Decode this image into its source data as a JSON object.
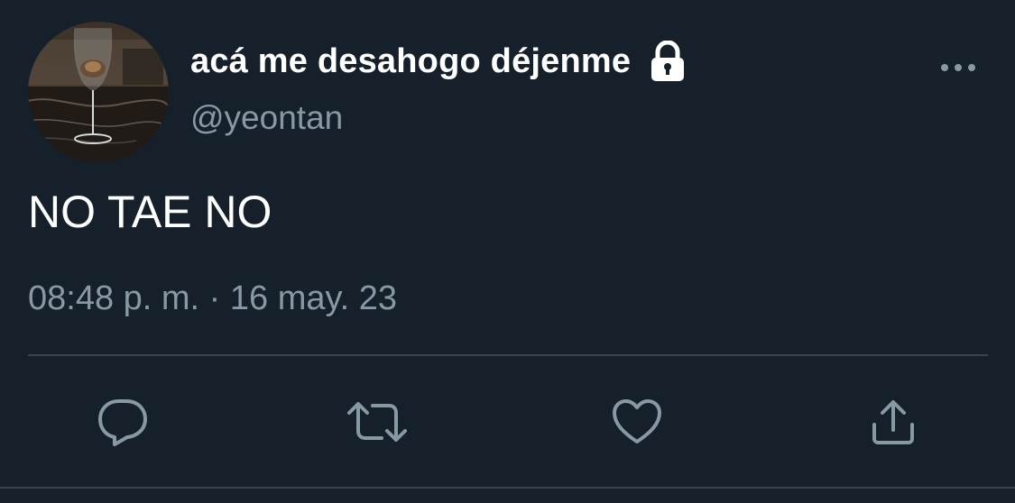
{
  "tweet": {
    "display_name": "acá me desahogo déjenme",
    "handle": "@yeontan",
    "text": "NO TAE NO",
    "timestamp": "08:48 p. m. · 16 may. 23",
    "protected": true
  },
  "icons": {
    "lock": "lock-icon",
    "more": "more-options-icon",
    "reply": "reply-icon",
    "retweet": "retweet-icon",
    "like": "like-icon",
    "share": "share-icon"
  },
  "colors": {
    "background": "#15202b",
    "primary_text": "#ffffff",
    "secondary_text": "#8899a6",
    "divider": "#38444d"
  }
}
